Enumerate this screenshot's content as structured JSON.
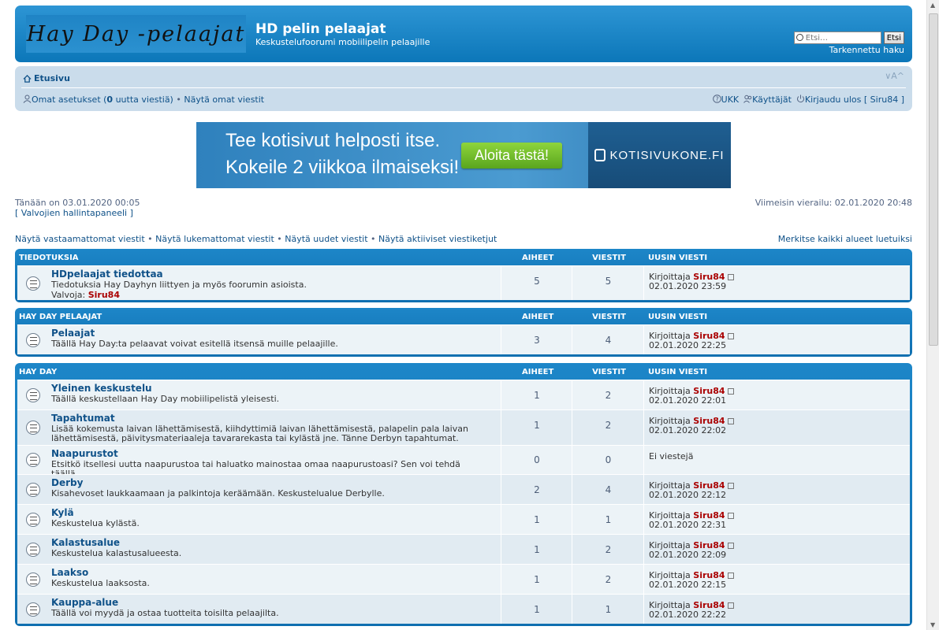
{
  "header": {
    "logo_text": "Hay Day -pelaajat",
    "site_title": "HD pelin pelaajat",
    "site_description": "Keskustelufoorumi mobiilipelin pelaajille",
    "search_placeholder": "Etsi…",
    "search_button": "Etsi",
    "advanced_search": "Tarkennettu haku"
  },
  "navbar": {
    "home": "Etusivu",
    "font_resize": "∨A^",
    "user_left_prefix": "Omat asetukset (",
    "new_messages_count": "0",
    "user_left_suffix": " uutta viestiä)",
    "sep": " • ",
    "own_posts": "Näytä omat viestit",
    "faq": "UKK",
    "members": "Käyttäjät",
    "logout": "Kirjaudu ulos [ Siru84 ]"
  },
  "banner": {
    "line1": "Tee kotisivut helposti itse.",
    "line2": "Kokeile 2 viikkoa ilmaiseksi!",
    "cta": "Aloita tästä!",
    "brand": "KOTISIVUKONE.FI"
  },
  "info": {
    "date": "Tänään on 03.01.2020 00:05",
    "mod_panel": "[ Valvojien hallintapaneeli ]",
    "last_visit": "Viimeisin vierailu: 02.01.2020 20:48",
    "quick_links": [
      "Näytä vastaamattomat viestit",
      "Näytä lukemattomat viestit",
      "Näytä uudet viestit",
      "Näytä aktiiviset viestiketjut"
    ],
    "bullet": " • ",
    "mark_read": "Merkitse kaikki alueet luetuiksi"
  },
  "columns": {
    "topics": "AIHEET",
    "posts": "VIESTIT",
    "last_post": "UUSIN VIESTI"
  },
  "categories": [
    {
      "name": "TIEDOTUKSIA",
      "forums": [
        {
          "title": "HDpelaajat tiedottaa",
          "desc": "Tiedotuksia Hay Dayhyn liittyen ja myös foorumin asioista.",
          "mod_label": "Valvoja: ",
          "mod_name": "Siru84",
          "topics": "5",
          "posts": "5",
          "by": "Kirjoittaja ",
          "author": "Siru84",
          "time": "02.01.2020 23:59"
        }
      ]
    },
    {
      "name": "HAY DAY PELAAJAT",
      "forums": [
        {
          "title": "Pelaajat",
          "desc": "Täällä Hay Day:ta pelaavat voivat esitellä itsensä muille pelaajille.",
          "topics": "3",
          "posts": "4",
          "by": "Kirjoittaja ",
          "author": "Siru84",
          "time": "02.01.2020 22:25"
        }
      ]
    },
    {
      "name": "HAY DAY",
      "forums": [
        {
          "title": "Yleinen keskustelu",
          "desc": "Täällä keskustellaan Hay Day mobiilipelistä yleisesti.",
          "topics": "1",
          "posts": "2",
          "by": "Kirjoittaja ",
          "author": "Siru84",
          "time": "02.01.2020 22:01"
        },
        {
          "title": "Tapahtumat",
          "desc": "Lisää kokemusta laivan lähettämisestä, kiihdyttimiä laivan lähettämisestä, palapelin pala laivan lähettämisestä, päivitysmateriaaleja tavararekasta tai kylästä jne. Tänne Derbyn tapahtumat.",
          "topics": "1",
          "posts": "2",
          "by": "Kirjoittaja ",
          "author": "Siru84",
          "time": "02.01.2020 22:02"
        },
        {
          "title": "Naapurustot",
          "desc": "Etsitkö itsellesi uutta naapurustoa tai haluatko mainostaa omaa naapurustoasi? Sen voi tehdä täällä.",
          "topics": "0",
          "posts": "0",
          "no_posts": "Ei viestejä"
        },
        {
          "title": "Derby",
          "desc": "Kisahevoset laukkaamaan ja palkintoja keräämään. Keskustelualue Derbylle.",
          "topics": "2",
          "posts": "4",
          "by": "Kirjoittaja ",
          "author": "Siru84",
          "time": "02.01.2020 22:12"
        },
        {
          "title": "Kylä",
          "desc": "Keskustelua kylästä.",
          "topics": "1",
          "posts": "1",
          "by": "Kirjoittaja ",
          "author": "Siru84",
          "time": "02.01.2020 22:31"
        },
        {
          "title": "Kalastusalue",
          "desc": "Keskustelua kalastusalueesta.",
          "topics": "1",
          "posts": "2",
          "by": "Kirjoittaja ",
          "author": "Siru84",
          "time": "02.01.2020 22:09"
        },
        {
          "title": "Laakso",
          "desc": "Keskustelua laaksosta.",
          "topics": "1",
          "posts": "2",
          "by": "Kirjoittaja ",
          "author": "Siru84",
          "time": "02.01.2020 22:15"
        },
        {
          "title": "Kauppa-alue",
          "desc": "Täällä voi myydä ja ostaa tuotteita toisilta pelaajilta.",
          "topics": "1",
          "posts": "1",
          "by": "Kirjoittaja ",
          "author": "Siru84",
          "time": "02.01.2020 22:22"
        }
      ]
    }
  ],
  "colors": {
    "header_blue": "#0c77b9",
    "nav_bg": "#cadceb",
    "author_red": "#aa0000",
    "link": "#105289"
  }
}
